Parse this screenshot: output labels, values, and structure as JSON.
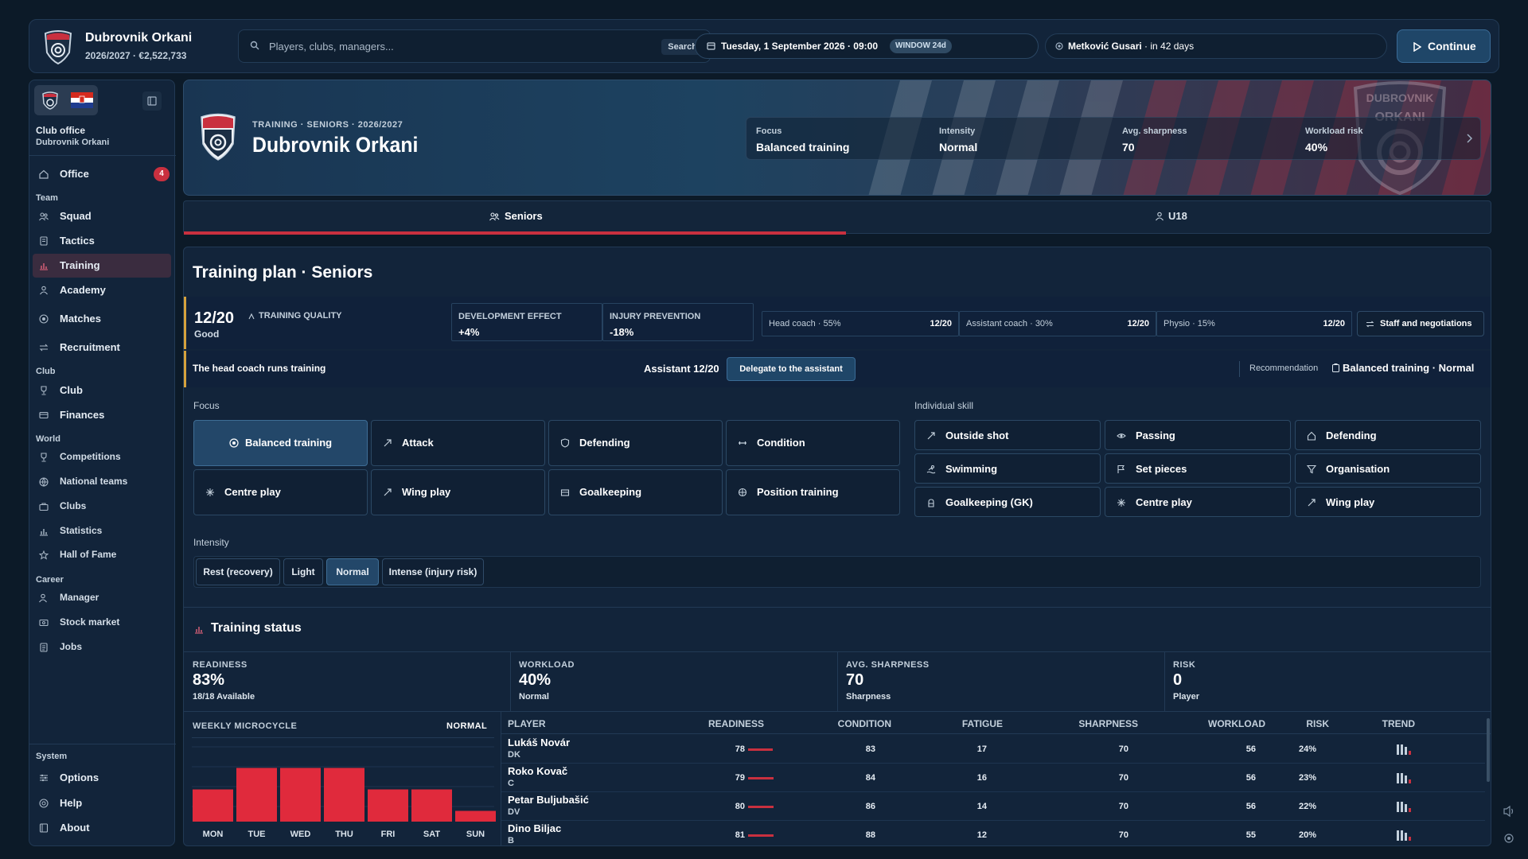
{
  "header": {
    "club_name": "Dubrovnik Orkani",
    "club_sub": "2026/2027 · €2,522,733",
    "search_placeholder": "Players, clubs, managers...",
    "search_button": "Search",
    "date": "Tuesday, 1 September 2026 · 09:00",
    "window_badge": "WINDOW 24d",
    "next_match_opponent": "Metković Gusari",
    "next_match_when": " · in 42 days",
    "continue_label": "Continue"
  },
  "sidebar": {
    "office_label": "Club office",
    "office_club": "Dubrovnik Orkani",
    "office_item": "Office",
    "office_badge": "4",
    "team_label": "Team",
    "squad": "Squad",
    "tactics": "Tactics",
    "training": "Training",
    "academy": "Academy",
    "matches": "Matches",
    "recruitment": "Recruitment",
    "club_label": "Club",
    "club": "Club",
    "finances": "Finances",
    "world_label": "World",
    "competitions": "Competitions",
    "national_teams": "National teams",
    "clubs": "Clubs",
    "statistics": "Statistics",
    "hall_of_fame": "Hall of Fame",
    "career_label": "Career",
    "manager": "Manager",
    "stock_market": "Stock market",
    "jobs": "Jobs",
    "system_label": "System",
    "options": "Options",
    "help": "Help",
    "about": "About"
  },
  "hero": {
    "breadcrumb": "TRAINING · SENIORS · 2026/2027",
    "title": "Dubrovnik Orkani",
    "crest_text_1": "DUBROVNIK",
    "crest_text_2": "ORKANI",
    "focus_label": "Focus",
    "focus_value": "Balanced training",
    "intensity_label": "Intensity",
    "intensity_value": "Normal",
    "sharpness_label": "Avg. sharpness",
    "sharpness_value": "70",
    "risk_label": "Workload risk",
    "risk_value": "40%"
  },
  "tabs": {
    "seniors": "Seniors",
    "u18": "U18"
  },
  "plan": {
    "title": "Training plan · Seniors",
    "quality_value": "12/20",
    "quality_label": "TRAINING QUALITY",
    "quality_word": "Good",
    "dev_label": "DEVELOPMENT EFFECT",
    "dev_value": "+4%",
    "inj_label": "INJURY PREVENTION",
    "inj_value": "-18%",
    "head_coach": "Head coach · 55%",
    "head_coach_score": "12/20",
    "assistant_coach": "Assistant coach · 30%",
    "assistant_coach_score": "12/20",
    "physio": "Physio · 15%",
    "physio_score": "12/20",
    "staff_button": "Staff and negotiations",
    "runs_text": "The head coach runs training",
    "assistant_text": "Assistant 12/20",
    "delegate_button": "Delegate to the assistant",
    "recommendation_label": "Recommendation",
    "recommendation_value": "Balanced training · Normal",
    "focus_label": "Focus",
    "skill_label": "Individual skill",
    "intensity_label": "Intensity"
  },
  "focus_options": [
    "Balanced training",
    "Attack",
    "Defending",
    "Condition",
    "Centre play",
    "Wing play",
    "Goalkeeping",
    "Position training"
  ],
  "skill_options": [
    "Outside shot",
    "Passing",
    "Defending",
    "Swimming",
    "Set pieces",
    "Organisation",
    "Goalkeeping (GK)",
    "Centre play",
    "Wing play"
  ],
  "intensity_options": [
    "Rest (recovery)",
    "Light",
    "Normal",
    "Intense (injury risk)"
  ],
  "status": {
    "title": "Training status",
    "readiness_label": "READINESS",
    "readiness_value": "83%",
    "readiness_sub": "18/18 Available",
    "workload_label": "WORKLOAD",
    "workload_value": "40%",
    "workload_sub": "Normal",
    "sharpness_label": "AVG. SHARPNESS",
    "sharpness_value": "70",
    "sharpness_sub": "Sharpness",
    "risk_label": "RISK",
    "risk_value": "0",
    "risk_sub": "Player"
  },
  "microcycle": {
    "title": "WEEKLY MICROCYCLE",
    "mode": "NORMAL",
    "days": [
      "MON",
      "TUE",
      "WED",
      "THU",
      "FRI",
      "SAT",
      "SUN"
    ],
    "loads": [
      0.45,
      0.75,
      0.75,
      0.75,
      0.45,
      0.45,
      0.15
    ]
  },
  "table": {
    "headers": [
      "PLAYER",
      "READINESS",
      "CONDITION",
      "FATIGUE",
      "SHARPNESS",
      "WORKLOAD",
      "RISK",
      "TREND"
    ],
    "rows": [
      {
        "name": "Lukáš Novár",
        "pos": "DK",
        "readiness": "78",
        "condition": "83",
        "fatigue": "17",
        "sharpness": "70",
        "workload": "56",
        "risk": "24%"
      },
      {
        "name": "Roko Kovač",
        "pos": "C",
        "readiness": "79",
        "condition": "84",
        "fatigue": "16",
        "sharpness": "70",
        "workload": "56",
        "risk": "23%"
      },
      {
        "name": "Petar Buljubašić",
        "pos": "DV",
        "readiness": "80",
        "condition": "86",
        "fatigue": "14",
        "sharpness": "70",
        "workload": "56",
        "risk": "22%"
      },
      {
        "name": "Dino Biljac",
        "pos": "B",
        "readiness": "81",
        "condition": "88",
        "fatigue": "12",
        "sharpness": "70",
        "workload": "55",
        "risk": "20%"
      }
    ]
  },
  "colors": {
    "accent": "#c9303f",
    "panel": "#12243a",
    "selected": "#234769"
  }
}
